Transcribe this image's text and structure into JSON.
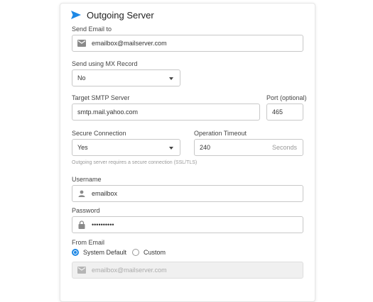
{
  "header": {
    "title": "Outgoing Server",
    "icon": "send-icon",
    "accent": "#1e88e5"
  },
  "send_email_to": {
    "label": "Send Email to",
    "value": "emailbox@mailserver.com",
    "icon": "mail-icon"
  },
  "mx_record": {
    "label": "Send using MX Record",
    "value": "No"
  },
  "smtp_server": {
    "label": "Target SMTP Server",
    "value": "smtp.mail.yahoo.com"
  },
  "port": {
    "label": "Port (optional)",
    "value": "465"
  },
  "secure_connection": {
    "label": "Secure Connection",
    "value": "Yes",
    "hint": "Outgoing server requires a secure connection (SSL/TLS)"
  },
  "timeout": {
    "label": "Operation Timeout",
    "value": "240",
    "unit": "Seconds"
  },
  "username": {
    "label": "Username",
    "value": "emailbox",
    "icon": "user-icon"
  },
  "password": {
    "label": "Password",
    "value": "••••••••••",
    "icon": "lock-icon"
  },
  "from_email": {
    "label": "From Email",
    "options": [
      {
        "label": "System Default",
        "selected": true
      },
      {
        "label": "Custom",
        "selected": false
      }
    ],
    "value": "emailbox@mailserver.com",
    "icon": "mail-icon"
  }
}
